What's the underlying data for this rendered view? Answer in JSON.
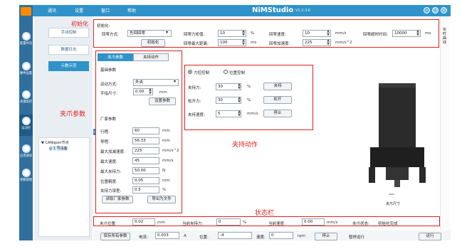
{
  "app": {
    "title": "NiMStudio",
    "version": "V1.2.3.6"
  },
  "menu": [
    "通讯",
    "设置",
    "窗口",
    "帮助"
  ],
  "window_controls": {
    "minimize": "–",
    "maximize": "□",
    "close": "×"
  },
  "rail": [
    {
      "label": "配置导向",
      "icon": "settings-wizard-icon"
    },
    {
      "label": "硬件设置",
      "icon": "hardware-icon"
    },
    {
      "label": "关键监控",
      "icon": "monitor-icon"
    },
    {
      "label": "运动控",
      "icon": "motion-control-icon"
    },
    {
      "label": "应用调试",
      "icon": "debug-icon"
    },
    {
      "label": "参数管理",
      "icon": "parameter-icon"
    }
  ],
  "subnav": {
    "items": [
      "手动控制",
      "数据日志",
      "示教示范"
    ],
    "active_index": 2
  },
  "tree": {
    "root": "CANopen节点",
    "child": "1 号设备"
  },
  "init": {
    "section_title": "初始化:",
    "mode_label": "回零方式:",
    "mode_value": "先回回零",
    "init_button": "初始化",
    "force_label": "回零力矩值:",
    "force_value": "10",
    "force_unit": "%",
    "pos_label": "回零最大距离:",
    "pos_value": "100",
    "pos_unit": "ms",
    "speed_label": "回零速度:",
    "speed_value": "10",
    "speed_unit": "mm/s",
    "accel_label": "回零加速度:",
    "accel_value": "225",
    "accel_unit": "mm/s^2",
    "timeout_label": "回零超时时间:",
    "timeout_value": "10000",
    "timeout_unit": "ms"
  },
  "annotations": {
    "init": "初始化",
    "jaw_params": "夹爪参数",
    "grip_action": "夹持动作",
    "status_bar": "状态栏"
  },
  "tabs": {
    "params": "夹爪参数",
    "action": "夹持动作"
  },
  "jaw": {
    "basic_title": "基础参数",
    "dir_label": "运动方式:",
    "dir_value": "外夹",
    "jaw_size_label": "手指尺寸:",
    "jaw_size_value": "0.00",
    "jaw_size_unit": "mm",
    "set_button": "设置参数",
    "factory_title": "厂家参数",
    "rows": [
      {
        "label": "行程:",
        "value": "60",
        "unit": "mm"
      },
      {
        "label": "导程:",
        "value": "56.33",
        "unit": "mm"
      },
      {
        "label": "最大加减速度:",
        "value": "225",
        "unit": "mm/s^2"
      },
      {
        "label": "最大速度:",
        "value": "45",
        "unit": "mm/s"
      },
      {
        "label": "最大夹持力:",
        "value": "50.00",
        "unit": "N"
      },
      {
        "label": "位置精度:",
        "value": "0.05",
        "unit": "mm"
      },
      {
        "label": "夹持力误差:",
        "value": "0.5",
        "unit": "%"
      }
    ],
    "read_button": "读取厂家参数",
    "export_button": "导出为文件"
  },
  "action": {
    "mode_force": "力控控制",
    "mode_position": "位置控制",
    "grip_label": "夹持力:",
    "grip_value": "30",
    "grip_unit": "%",
    "grip_button": "夹持",
    "open_label": "松开力:",
    "open_value": "30",
    "open_unit": "%",
    "open_button": "松开",
    "speed_label": "夹持速度:",
    "speed_value": "5",
    "speed_unit": "mm/s",
    "stop_button": "停止"
  },
  "gripper": {
    "caption": "夹爪尺寸"
  },
  "status": {
    "pos_label": "夹爪位置:",
    "pos_value": "0.02",
    "pos_unit": "mm",
    "force_label": "当前夹持力:",
    "force_value": "0",
    "force_unit": "%",
    "speed_label": "当前速度:",
    "speed_value": "0.00",
    "speed_unit": "mm/s",
    "state_label": "夹爪状态:",
    "state_value": "初始化完成"
  },
  "bottom": {
    "save_button": "保存所有参数",
    "current_label": "电流:",
    "current_value": "0.003",
    "current_unit": "A",
    "pos_label": "位置:",
    "pos_value": "-4",
    "speed_label": "速度:",
    "speed_value": "0",
    "speed_unit": "rpm",
    "stop_button": "停止",
    "status_text": "暂停运行",
    "run_button": "运行"
  },
  "right_strip": "实时曲线"
}
